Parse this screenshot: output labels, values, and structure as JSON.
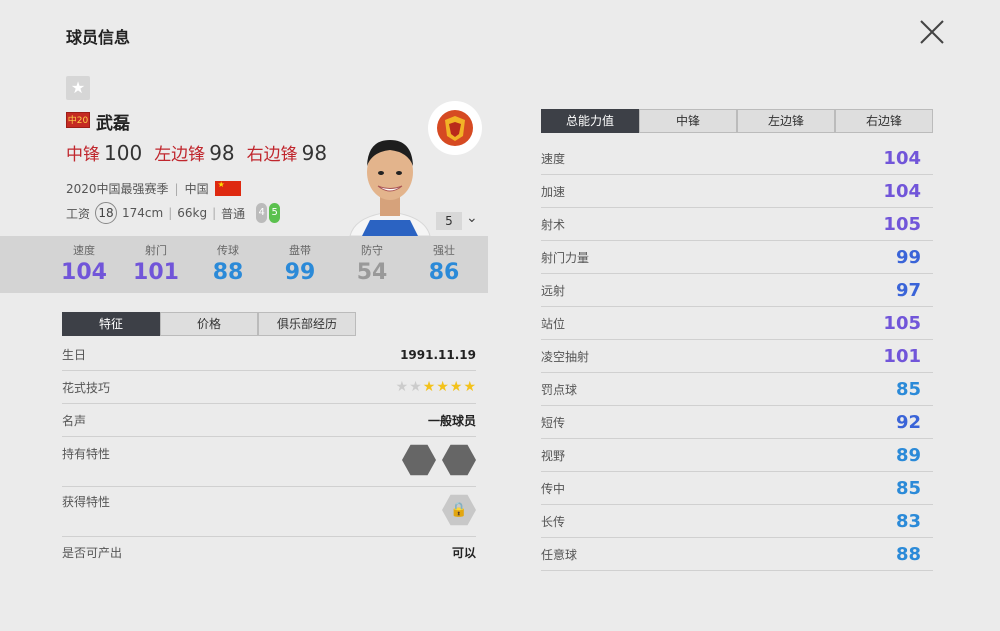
{
  "header": {
    "title": "球员信息"
  },
  "player": {
    "position_badge": "中20",
    "name": "武磊",
    "ratings": [
      {
        "pos": "中锋",
        "val": "100"
      },
      {
        "pos": "左边锋",
        "val": "98"
      },
      {
        "pos": "右边锋",
        "val": "98"
      }
    ],
    "season": "2020中国最强赛季",
    "nation": "中国",
    "wage_label": "工资",
    "wage": "18",
    "height": "174cm",
    "weight": "66kg",
    "body_type": "普通",
    "left_foot": "4",
    "right_foot": "5",
    "level": "5"
  },
  "summary_stats": [
    {
      "label": "速度",
      "val": "104",
      "color": "purple"
    },
    {
      "label": "射门",
      "val": "101",
      "color": "purple"
    },
    {
      "label": "传球",
      "val": "88",
      "color": "blue"
    },
    {
      "label": "盘带",
      "val": "99",
      "color": "blue"
    },
    {
      "label": "防守",
      "val": "54",
      "color": "gray"
    },
    {
      "label": "强壮",
      "val": "86",
      "color": "blue"
    }
  ],
  "info_tabs": [
    "特征",
    "价格",
    "俱乐部经历"
  ],
  "info": {
    "birthday_label": "生日",
    "birthday": "1991.11.19",
    "skill_label": "花式技巧",
    "skill_stars": 4,
    "skill_max": 6,
    "fame_label": "名声",
    "fame": "一般球员",
    "traits_label": "持有特性",
    "acquire_label": "获得特性",
    "produce_label": "是否可产出",
    "produce": "可以"
  },
  "attr_tabs": [
    "总能力值",
    "中锋",
    "左边锋",
    "右边锋"
  ],
  "attributes": [
    {
      "label": "速度",
      "val": "104",
      "color": "#7155d9"
    },
    {
      "label": "加速",
      "val": "104",
      "color": "#7155d9"
    },
    {
      "label": "射术",
      "val": "105",
      "color": "#7155d9"
    },
    {
      "label": "射门力量",
      "val": "99",
      "color": "#3a64d8"
    },
    {
      "label": "远射",
      "val": "97",
      "color": "#3a64d8"
    },
    {
      "label": "站位",
      "val": "105",
      "color": "#7155d9"
    },
    {
      "label": "凌空抽射",
      "val": "101",
      "color": "#7155d9"
    },
    {
      "label": "罚点球",
      "val": "85",
      "color": "#2b8ad8"
    },
    {
      "label": "短传",
      "val": "92",
      "color": "#3a64d8"
    },
    {
      "label": "视野",
      "val": "89",
      "color": "#2b8ad8"
    },
    {
      "label": "传中",
      "val": "85",
      "color": "#2b8ad8"
    },
    {
      "label": "长传",
      "val": "83",
      "color": "#2b8ad8"
    },
    {
      "label": "任意球",
      "val": "88",
      "color": "#2b8ad8"
    }
  ]
}
